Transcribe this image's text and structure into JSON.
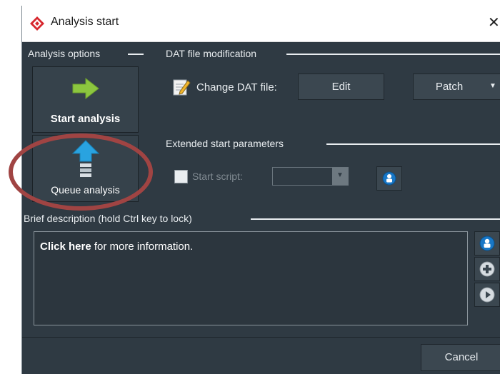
{
  "window": {
    "title": "Analysis start",
    "close_symbol": "✕"
  },
  "analysis_options": {
    "heading": "Analysis options",
    "start_button": "Start analysis",
    "queue_button": "Queue analysis"
  },
  "dat_modification": {
    "heading": "DAT file modification",
    "label": "Change DAT file:",
    "edit_button": "Edit",
    "patch_button": "Patch"
  },
  "extended_params": {
    "heading": "Extended start parameters",
    "start_script_label": "Start script:",
    "start_script_value": ""
  },
  "brief_description": {
    "heading": "Brief description (hold Ctrl key to lock)",
    "bold_text": "Click here",
    "rest_text": " for more information."
  },
  "footer": {
    "cancel_button": "Cancel"
  },
  "colors": {
    "background": "#2f3a43",
    "arrow_green": "#8cc63f",
    "arrow_blue": "#29a3e0",
    "highlight_ellipse": "#a04443"
  },
  "icons": [
    "app-logo-icon",
    "close-icon",
    "green-arrow-icon",
    "queue-icon",
    "edit-document-icon",
    "dropdown-arrow-icon",
    "user-badge-icon",
    "plus-icon",
    "play-icon"
  ]
}
